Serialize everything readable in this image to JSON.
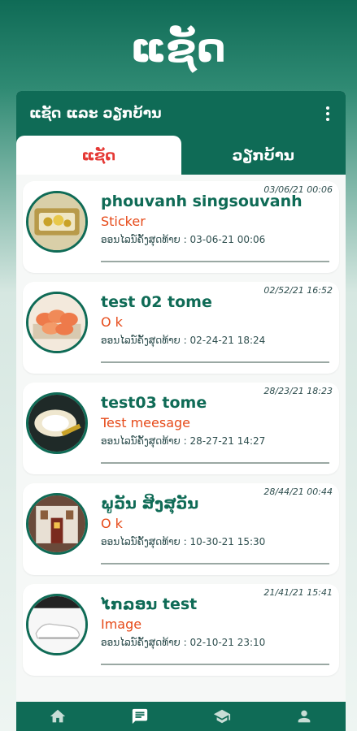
{
  "app": {
    "title": "ແຊັດ"
  },
  "header": {
    "title": "ແຊັດ ແລະ ວຽກບ້ານ",
    "menu_icon": "more-vert-icon"
  },
  "tabs": [
    {
      "label": "ແຊັດ",
      "active": true
    },
    {
      "label": "ວຽກບ້ານ",
      "active": false
    }
  ],
  "chats": [
    {
      "timestamp": "03/06/21 00:06",
      "name": "phouvanh singsouvanh",
      "message": "Sticker",
      "last_online": "ອອນໄລນ໌ຄັ້ງສຸດທ້າຍ : 03-06-21 00:06",
      "avatar": "jewelry"
    },
    {
      "timestamp": "02/52/21 16:52",
      "name": "test 02 tome",
      "message": "O k",
      "last_online": "ອອນໄລນ໌ຄັ້ງສຸດທ້າຍ : 02-24-21 18:24",
      "avatar": "sushi"
    },
    {
      "timestamp": "28/23/21 18:23",
      "name": "test03  tome",
      "message": "Test meesage",
      "last_online": "ອອນໄລນ໌ຄັ້ງສຸດທ້າຍ : 28-27-21 14:27",
      "avatar": "plate"
    },
    {
      "timestamp": "28/44/21 00:44",
      "name": "ພູວັນ ສິງສຸວັນ",
      "message": "O k",
      "last_online": "ອອນໄລນ໌ຄັ້ງສຸດທ້າຍ : 10-30-21 15:30",
      "avatar": "building"
    },
    {
      "timestamp": "21/41/21 15:41",
      "name": " ໄກລອນ test",
      "message": "Image",
      "last_online": "ອອນໄລນ໌ຄັ້ງສຸດທ້າຍ : 02-10-21 23:10",
      "avatar": "shoe"
    }
  ],
  "bottom_nav": [
    {
      "icon": "home-icon"
    },
    {
      "icon": "chat-icon"
    },
    {
      "icon": "school-icon"
    },
    {
      "icon": "person-icon"
    }
  ],
  "colors": {
    "primary": "#0f6b56",
    "accent_red": "#e53935",
    "message_orange": "#e64a19"
  }
}
